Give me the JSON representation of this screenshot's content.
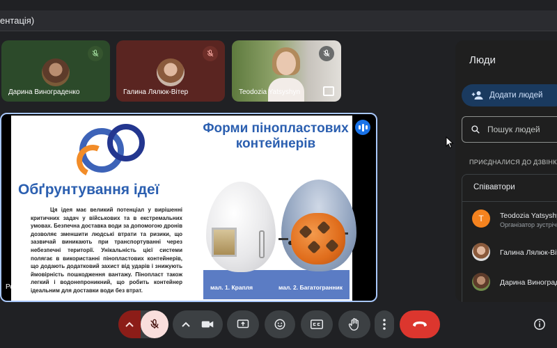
{
  "meeting": {
    "title": "ентація)"
  },
  "tiles": [
    {
      "name": "Дарина Винограденко",
      "muted": true
    },
    {
      "name": "Галина Лялюк-Вітер",
      "muted": true
    },
    {
      "name": "Teodozia Yatsyshyn",
      "muted": true
    }
  ],
  "presentation": {
    "presenter_label": "Ромашка Оля",
    "slide": {
      "heading_left": "Обґрунтування ідеї",
      "body": "Ця ідея має великий потенціал у вирішенні критичних задач у військових та в екстремальних умовах. Безпечна доставка води за допомогою дронів дозволяє зменшити людські втрати та ризики, що зазвичай виникають при транспортуванні через небезпечні території. Унікальність цієї системи полягає в використанні пінопластових контейнерів, що додають додатковий захист від ударів і знижують ймовірність пошкодження вантажу. Пінопласт також легкий і водонепроникний, що робить контейнер ідеальним для доставки води без втрат.",
      "title_right": "Форми пінопластових контейнерів",
      "caption_1": "мал. 1. Крапля",
      "caption_2": "мал. 2. Багатогранник"
    }
  },
  "people_panel": {
    "title": "Люди",
    "add_label": "Додати людей",
    "search_placeholder": "Пошук людей",
    "section_label": "ПРИЄДНАЛИСЯ ДО ДЗВІНКА",
    "group_label": "Співавтори",
    "people": [
      {
        "name": "Teodozia Yatsyshyn",
        "role": "Організатор зустрічі",
        "initial": "T"
      },
      {
        "name": "Галина Лялюк-Вітер",
        "role": ""
      },
      {
        "name": "Дарина Винограденко",
        "role": ""
      }
    ]
  },
  "colors": {
    "accent": "#a8c7fa",
    "leave": "#dc362e",
    "mic_muted_bg": "#f9dedc",
    "add_btn": "#1a3a5f"
  },
  "icons": [
    "mic-off-icon",
    "chevron-up-icon",
    "camera-icon",
    "present-icon",
    "emoji-icon",
    "captions-icon",
    "raise-hand-icon",
    "more-vert-icon",
    "call-end-icon",
    "info-icon",
    "person-add-icon",
    "search-icon",
    "audio-wave-icon",
    "pin-icon"
  ]
}
